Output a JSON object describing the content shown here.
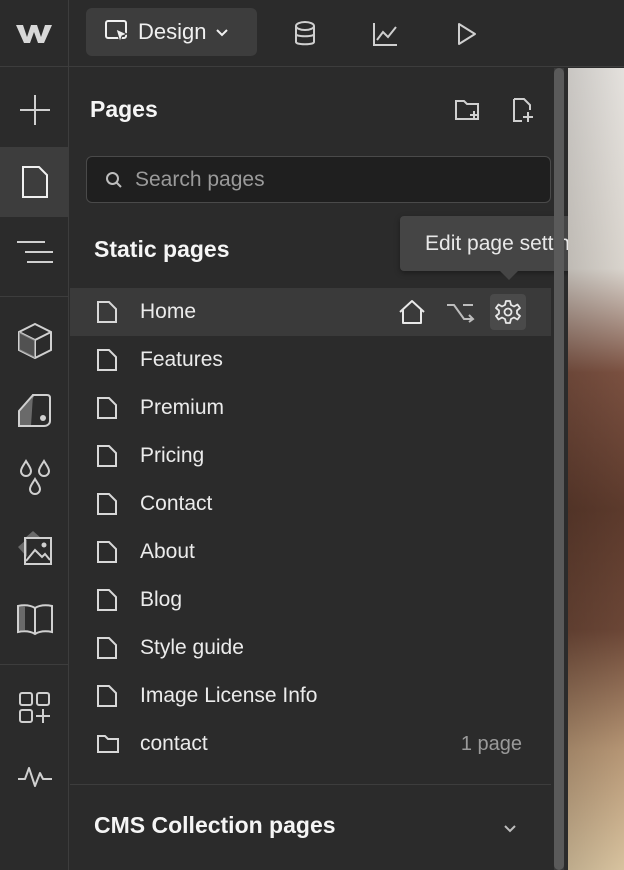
{
  "topbar": {
    "mode_label": "Design",
    "icons": [
      "webflow-logo-icon",
      "design-cursor-icon",
      "chevron-down-icon",
      "cms-database-icon",
      "analytics-chart-icon",
      "preview-play-icon"
    ]
  },
  "rail": {
    "items": [
      "add-plus-icon",
      "pages-icon",
      "navigator-icon",
      "components-cube-icon",
      "style-selectors-icon",
      "variables-drops-icon",
      "assets-image-icon",
      "library-book-icon",
      "apps-icon",
      "audit-pulse-icon"
    ]
  },
  "panel": {
    "title": "Pages",
    "search_placeholder": "Search pages",
    "static_section_title": "Static pages",
    "pages": [
      {
        "label": "Home",
        "icon": "page-icon"
      },
      {
        "label": "Features",
        "icon": "page-icon"
      },
      {
        "label": "Premium",
        "icon": "page-icon"
      },
      {
        "label": "Pricing",
        "icon": "page-icon"
      },
      {
        "label": "Contact",
        "icon": "page-icon"
      },
      {
        "label": "About",
        "icon": "page-icon"
      },
      {
        "label": "Blog",
        "icon": "page-icon"
      },
      {
        "label": "Style guide",
        "icon": "page-icon"
      },
      {
        "label": "Image License Info",
        "icon": "page-icon"
      },
      {
        "label": "contact",
        "icon": "folder-icon",
        "meta": "1 page"
      }
    ],
    "cms_section_title": "CMS Collection pages"
  },
  "tooltip": {
    "text": "Edit page settings"
  },
  "colors": {
    "background": "#2b2b2b",
    "active_rail": "#3d3d3d",
    "hover_row": "#3a3a3a",
    "text": "#ebebeb",
    "muted": "#9a9a9a"
  }
}
